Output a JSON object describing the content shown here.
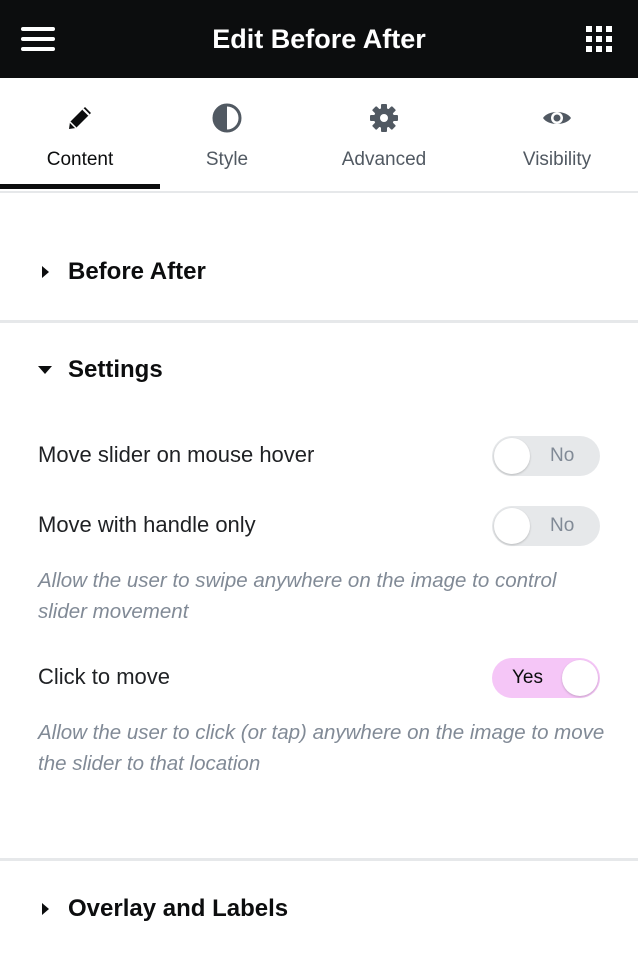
{
  "header": {
    "title": "Edit Before After",
    "menu_icon": "hamburger-menu-icon",
    "apps_icon": "grid-apps-icon"
  },
  "tabs": [
    {
      "label": "Content",
      "icon": "pencil-icon",
      "active": true
    },
    {
      "label": "Style",
      "icon": "half-circle-contrast-icon",
      "active": false
    },
    {
      "label": "Advanced",
      "icon": "gear-icon",
      "active": false
    },
    {
      "label": "Visibility",
      "icon": "eye-icon",
      "active": false
    }
  ],
  "sections": {
    "before_after": {
      "label": "Before After",
      "expanded": false
    },
    "settings": {
      "label": "Settings",
      "expanded": true
    },
    "overlay": {
      "label": "Overlay and Labels",
      "expanded": false
    }
  },
  "settings": {
    "hover": {
      "label": "Move slider on mouse hover",
      "value": "No",
      "on": false
    },
    "handle": {
      "label": "Move with handle only",
      "value": "No",
      "on": false,
      "description": "Allow the user to swipe anywhere on the image to control slider movement"
    },
    "click": {
      "label": "Click to move",
      "value": "Yes",
      "on": true,
      "description": "Allow the user to click (or tap) anywhere on the image to move the slider to that location"
    }
  },
  "colors": {
    "header_bg": "#0c0d0e",
    "toggle_on": "#f5c6f7",
    "toggle_off": "#e6e8ea",
    "description_text": "#818a96"
  }
}
